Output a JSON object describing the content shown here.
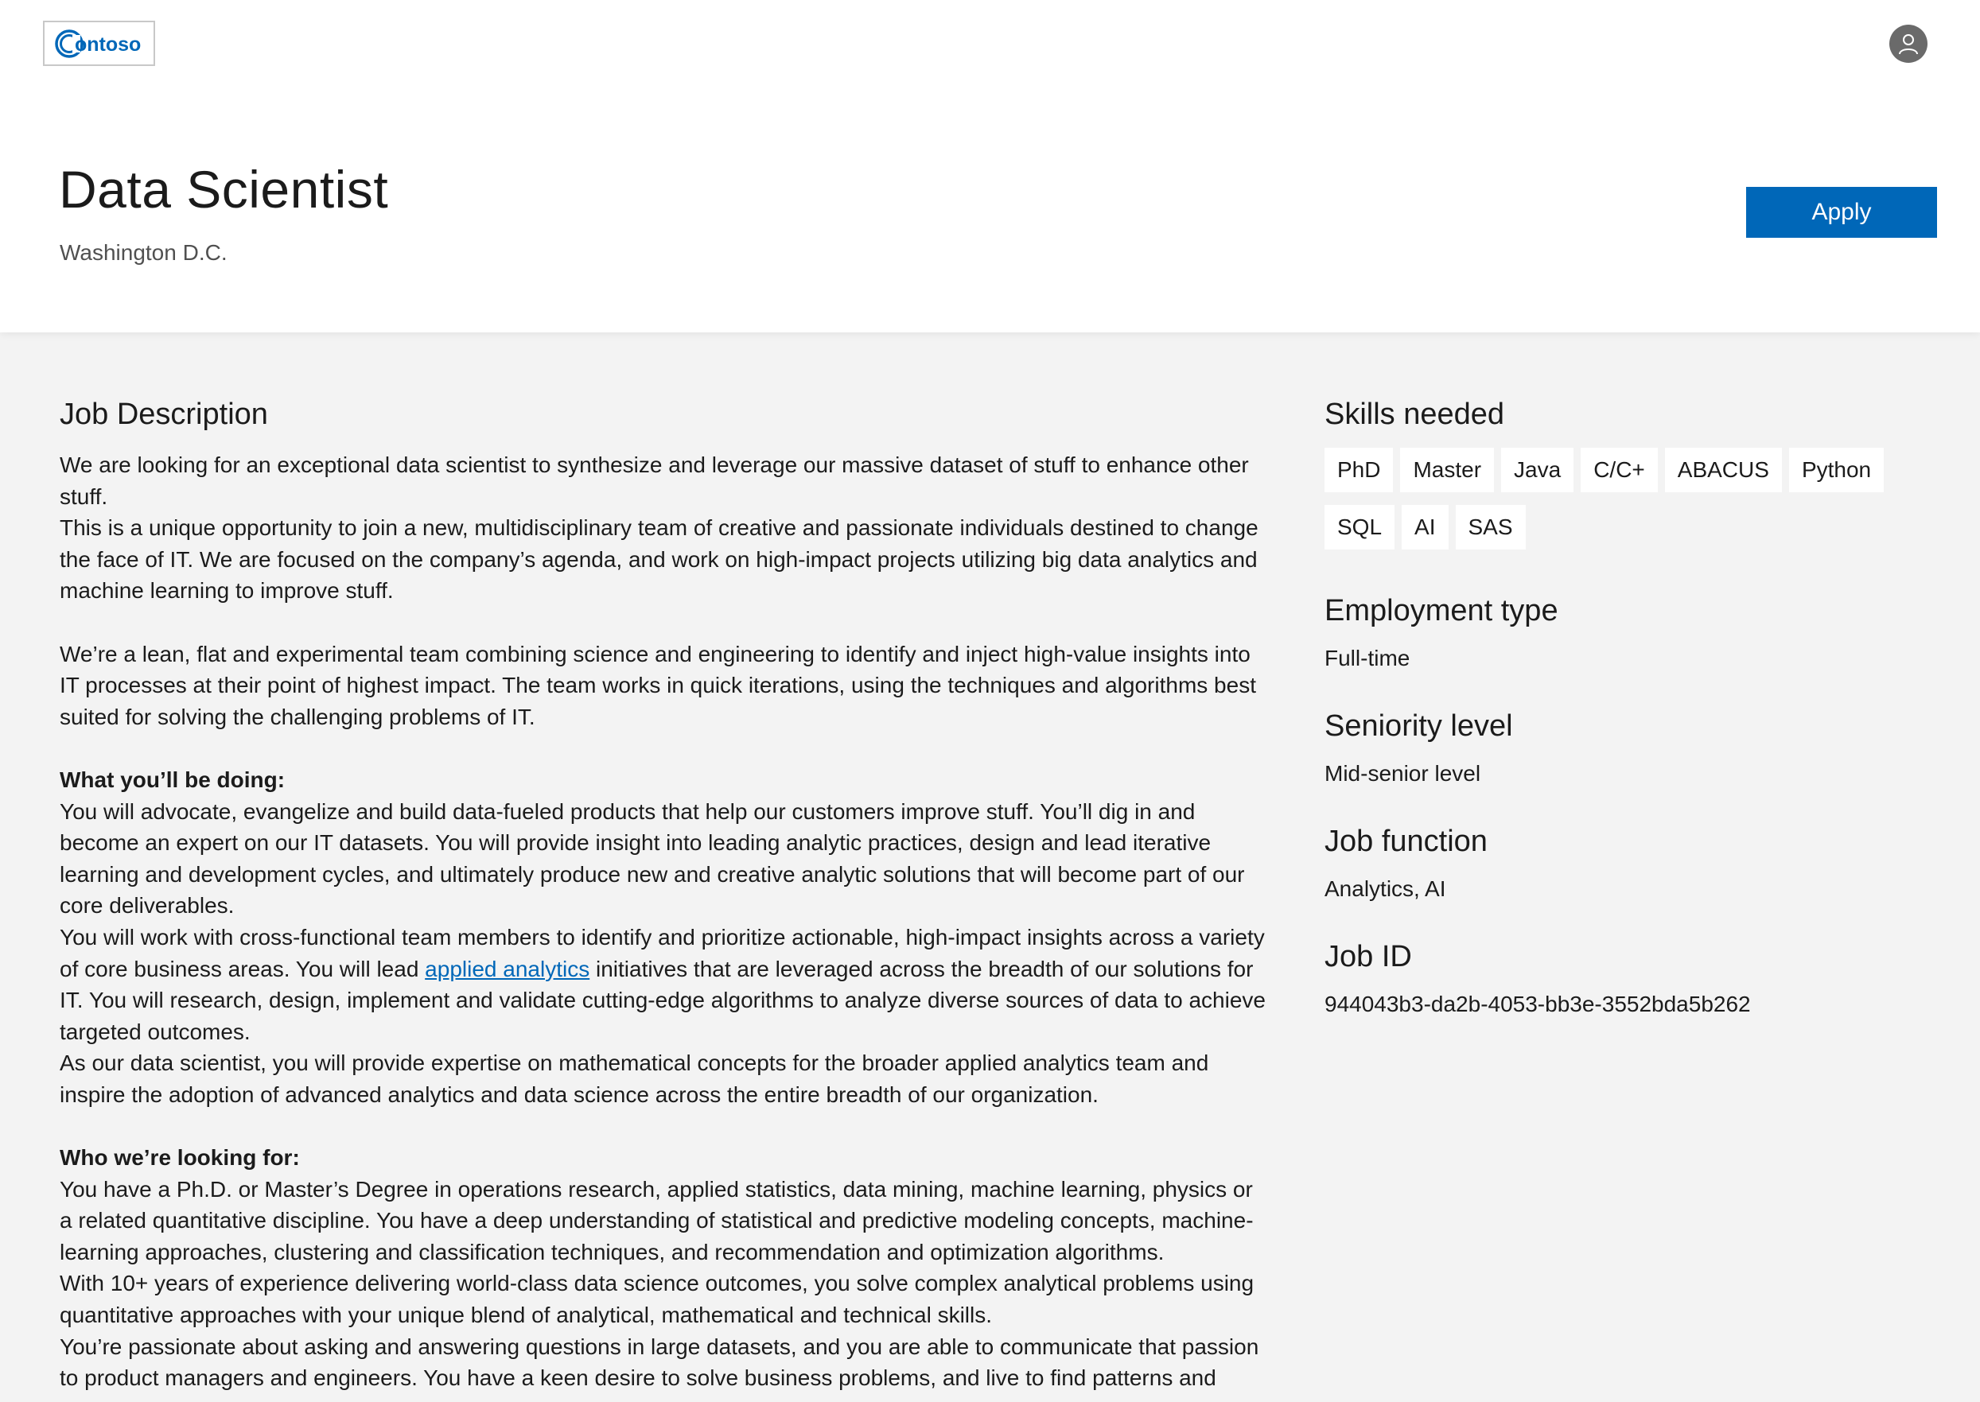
{
  "brand": {
    "name": "Contoso",
    "logo_text": "ontoso"
  },
  "job": {
    "title": "Data Scientist",
    "location": "Washington D.C.",
    "apply_label": "Apply"
  },
  "description": {
    "heading": "Job Description",
    "p1": "We are looking for an exceptional data scientist to synthesize and leverage our massive dataset of stuff to enhance other stuff.",
    "p2": "This is a unique opportunity to join a new, multidisciplinary team of creative and passionate individuals destined to change the face of IT. We are focused on the company’s agenda, and work on high-impact projects utilizing big data analytics and machine learning to improve stuff.",
    "p3": "We’re a lean, flat and experimental team combining science and engineering to identify and inject high-value insights into IT processes at their point of highest impact. The team works in quick iterations, using the techniques and algorithms best suited for solving the challenging problems of IT.",
    "doing_heading": "What you’ll be doing:",
    "p4": "You will advocate, evangelize and build data-fueled products that help our customers improve stuff. You’ll dig in and become an expert on our IT datasets. You will provide insight into leading analytic practices, design and lead iterative learning and development cycles, and ultimately produce new and creative analytic solutions that will become part of our core deliverables.",
    "p5_before": "You will work with cross-functional team members to identify and prioritize actionable, high-impact insights across a variety of core business areas. You will lead ",
    "p5_link": "applied analytics",
    "p5_after": " initiatives that are leveraged across the breadth of our solutions for IT. You will research, design, implement and validate cutting-edge algorithms to analyze diverse sources of data to achieve targeted outcomes.",
    "p6": "As our data scientist, you will provide expertise on mathematical concepts for the broader applied analytics team and inspire the adoption of advanced analytics and data science across the entire breadth of our organization.",
    "looking_heading": "Who we’re looking for:",
    "p7": "You have a Ph.D. or Master’s Degree in operations research, applied statistics, data mining, machine learning, physics or a related quantitative discipline. You have a deep understanding of statistical and predictive modeling concepts, machine-learning approaches, clustering and classification techniques, and recommendation and optimization algorithms.",
    "p8": "With 10+ years of experience delivering world-class data science outcomes, you solve complex analytical problems using quantitative approaches with your unique blend of analytical, mathematical and technical skills.",
    "p9": "You’re passionate about asking and answering questions in large datasets, and you are able to communicate that passion to product managers and engineers. You have a keen desire to solve business problems, and live to find patterns and"
  },
  "sidebar": {
    "skills_heading": "Skills needed",
    "skills": [
      "PhD",
      "Master",
      "Java",
      "C/C+",
      "ABACUS",
      "Python",
      "SQL",
      "AI",
      "SAS"
    ],
    "employment_heading": "Employment type",
    "employment_value": "Full-time",
    "seniority_heading": "Seniority level",
    "seniority_value": "Mid-senior level",
    "function_heading": "Job function",
    "function_value": "Analytics, AI",
    "id_heading": "Job ID",
    "id_value": "944043b3-da2b-4053-bb3e-3552bda5b262"
  },
  "colors": {
    "accent": "#0067b8",
    "page_bg": "#f3f3f3",
    "header_bg": "#ffffff",
    "avatar": "#6a6a6a"
  },
  "icons": {
    "avatar": "person-icon"
  }
}
